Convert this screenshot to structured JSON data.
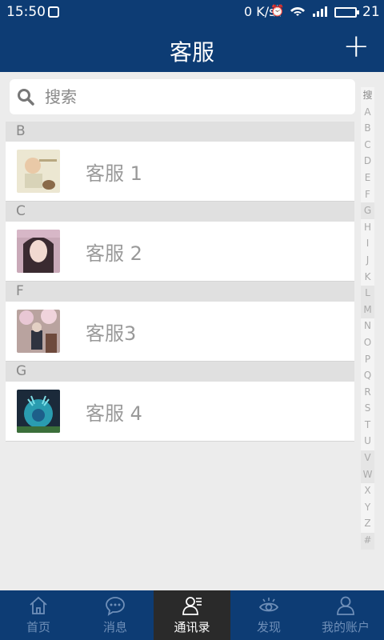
{
  "status_bar": {
    "time": "15:50",
    "net_speed": "0 K/s",
    "battery": "21"
  },
  "header": {
    "title": "客服",
    "add_label": "+"
  },
  "search": {
    "placeholder": "搜索"
  },
  "sections": [
    {
      "letter": "B",
      "name": "客服 1"
    },
    {
      "letter": "C",
      "name": "客服 2"
    },
    {
      "letter": "F",
      "name": "客服3"
    },
    {
      "letter": "G",
      "name": "客服 4"
    }
  ],
  "index_letters": [
    "搜",
    "A",
    "B",
    "C",
    "D",
    "E",
    "F",
    "G",
    "H",
    "I",
    "J",
    "K",
    "L",
    "M",
    "N",
    "O",
    "P",
    "Q",
    "R",
    "S",
    "T",
    "U",
    "V",
    "W",
    "X",
    "Y",
    "Z",
    "#"
  ],
  "tabs": [
    {
      "label": "首页",
      "icon": "home-icon"
    },
    {
      "label": "消息",
      "icon": "chat-icon"
    },
    {
      "label": "通讯录",
      "icon": "contacts-icon",
      "active": true
    },
    {
      "label": "发现",
      "icon": "eye-icon"
    },
    {
      "label": "我的账户",
      "icon": "person-icon"
    }
  ],
  "colors": {
    "brand": "#0d3c74",
    "active_tab": "#2a2a2a",
    "inactive_tab_text": "#6f8fb8"
  }
}
